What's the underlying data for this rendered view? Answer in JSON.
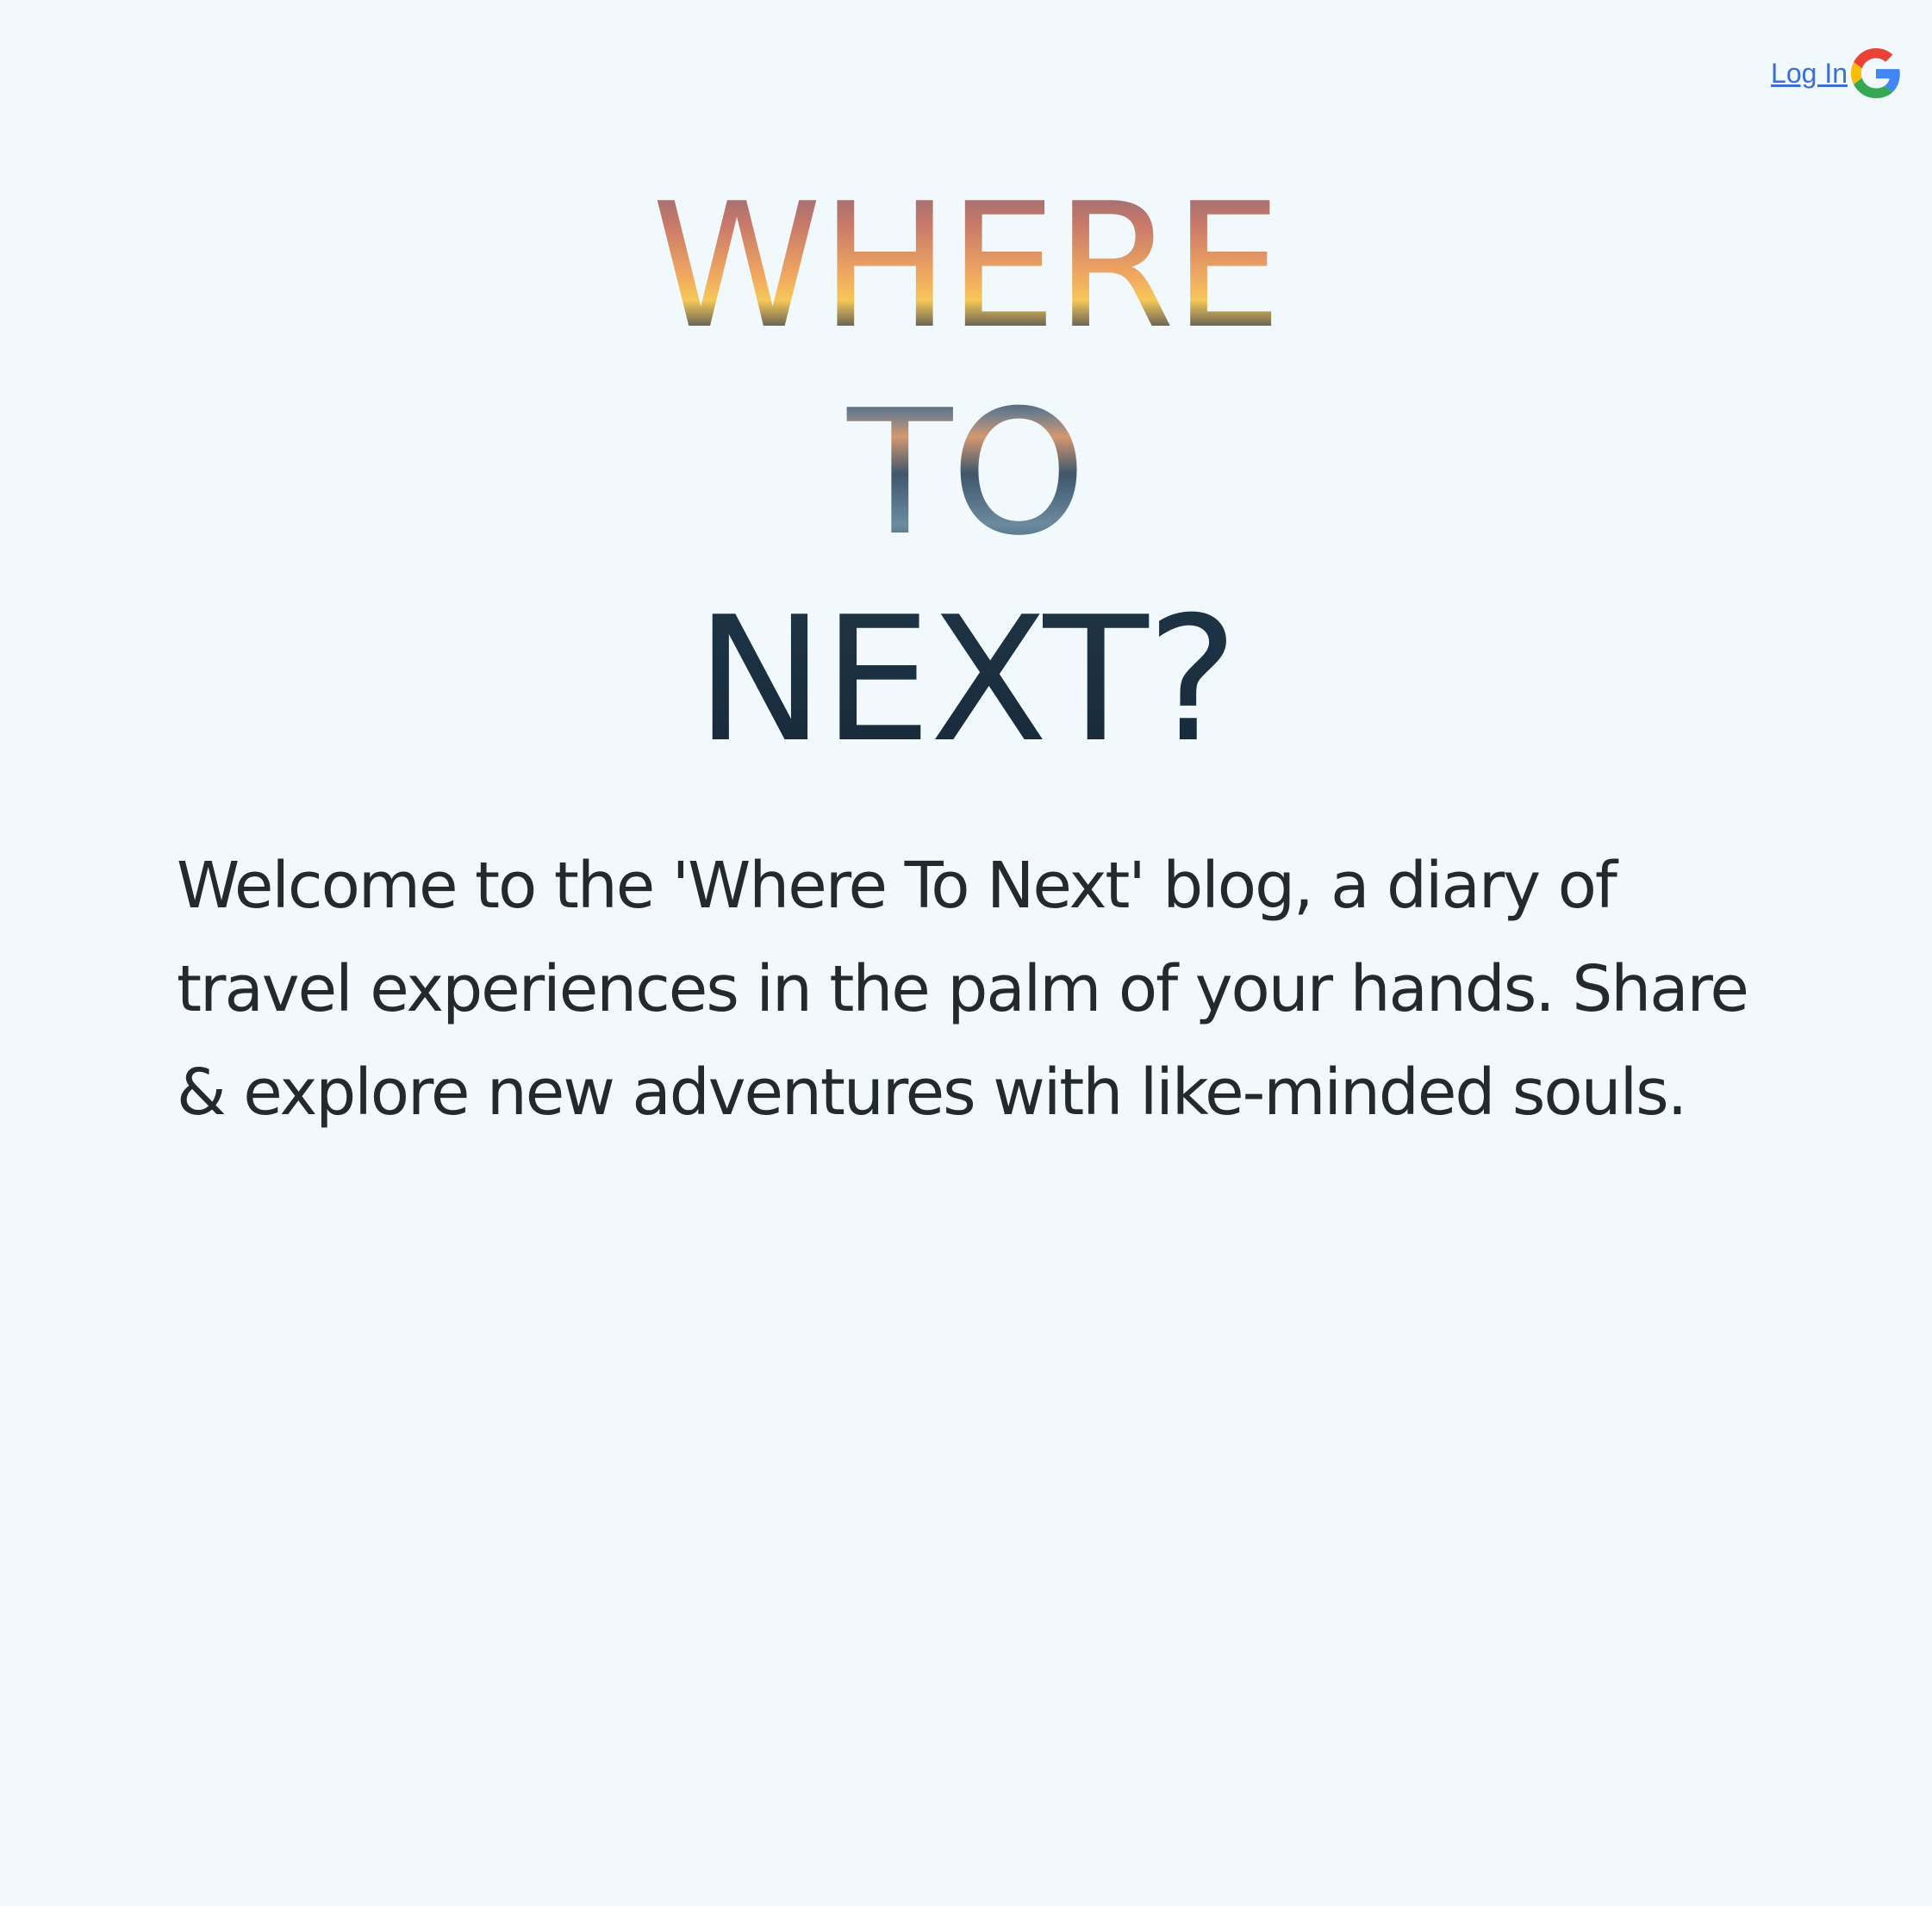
{
  "header": {
    "login_label": "Log In ",
    "login_icon": "google-icon"
  },
  "hero": {
    "line1": "WHERE",
    "line2": "TO",
    "line3": "NEXT?"
  },
  "intro": {
    "text": "Welcome to the 'Where To Next' blog, a diary of travel experiences in the palm of your hands. Share & explore new adventures with like-minded souls."
  },
  "colors": {
    "background": "#f1f9fd",
    "link": "#3b6fd4",
    "body_text": "#222a30"
  }
}
